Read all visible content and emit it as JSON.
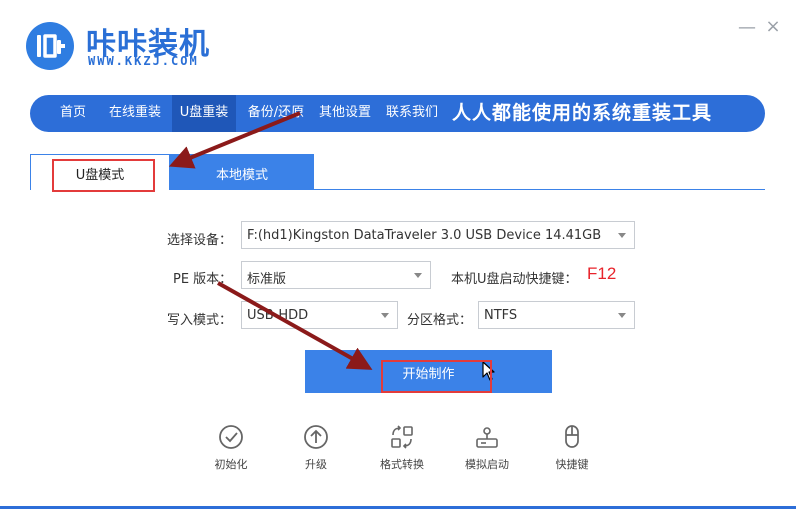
{
  "app": {
    "title": "咔咔装机",
    "url": "WWW.KKZJ.COM",
    "logo_text": "咔"
  },
  "window": {
    "minimize": "—",
    "close": "×"
  },
  "nav": {
    "items": [
      {
        "label": "首页"
      },
      {
        "label": "在线重装"
      },
      {
        "label": "U盘重装"
      },
      {
        "label": "备份/还原"
      },
      {
        "label": "其他设置"
      },
      {
        "label": "联系我们"
      }
    ],
    "active_index": 2,
    "slogan": "人人都能使用的系统重装工具"
  },
  "tabs": [
    {
      "label": "U盘模式",
      "active": true
    },
    {
      "label": "本地模式",
      "active": false
    }
  ],
  "form": {
    "device_label": "选择设备：",
    "device_value": "F:(hd1)Kingston DataTraveler 3.0 USB Device 14.41GB",
    "pe_label": "PE 版本：",
    "pe_value": "标准版",
    "hotkey_label": "本机U盘启动快捷键：",
    "hotkey_value": "F12",
    "write_label": "写入模式：",
    "write_value": "USB-HDD",
    "partition_label": "分区格式：",
    "partition_value": "NTFS"
  },
  "start_button": {
    "label": "开始制作"
  },
  "tools": [
    {
      "label": "初始化",
      "icon": "check-circle-icon"
    },
    {
      "label": "升级",
      "icon": "upgrade-arrow-icon"
    },
    {
      "label": "格式转换",
      "icon": "convert-icon"
    },
    {
      "label": "模拟启动",
      "icon": "simulate-boot-icon"
    },
    {
      "label": "快捷键",
      "icon": "mouse-icon"
    }
  ],
  "colors": {
    "brand": "#2d6ed8",
    "accent": "#3b82e8",
    "highlight": "#e33b3b",
    "arrow": "#8b1a1a",
    "hotkey": "#e8232b"
  }
}
